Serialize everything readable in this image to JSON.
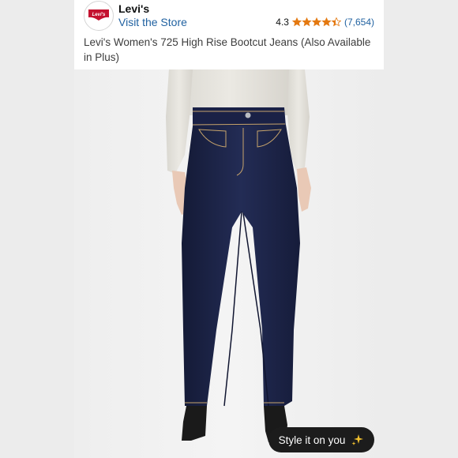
{
  "store": {
    "logo_text": "Levi's",
    "name": "Levi's",
    "visit_link": "Visit the Store"
  },
  "rating": {
    "value": "4.3",
    "stars": 4.3,
    "review_count": "(7,654)",
    "star_color": "#e47911"
  },
  "product": {
    "title": "Levi's Women's 725 High Rise Bootcut Jeans (Also Available in Plus)",
    "image_icon": "product-photo-jeans"
  },
  "style_button": {
    "label": "Style it on you",
    "icon": "sparkle-icon",
    "sparkle_color": "#f2c12e"
  },
  "colors": {
    "link": "#2162a1",
    "denim": "#1c2447",
    "stitch": "#c7a46c"
  }
}
